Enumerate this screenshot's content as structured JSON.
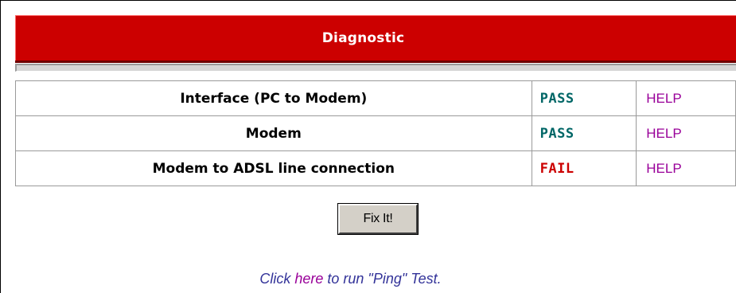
{
  "header": {
    "title": "Diagnostic"
  },
  "tests": [
    {
      "label": "Interface (PC to Modem)",
      "status": "PASS",
      "help": "HELP"
    },
    {
      "label": "Modem",
      "status": "PASS",
      "help": "HELP"
    },
    {
      "label": "Modem to ADSL line connection",
      "status": "FAIL",
      "help": "HELP"
    }
  ],
  "fix_button": {
    "label": "Fix It!"
  },
  "ping": {
    "prefix": "Click ",
    "link": "here",
    "suffix": " to run \"Ping\" Test."
  },
  "colors": {
    "header_bg": "#cc0000",
    "pass": "#006666",
    "fail": "#cc0000",
    "help_link": "#990099"
  }
}
